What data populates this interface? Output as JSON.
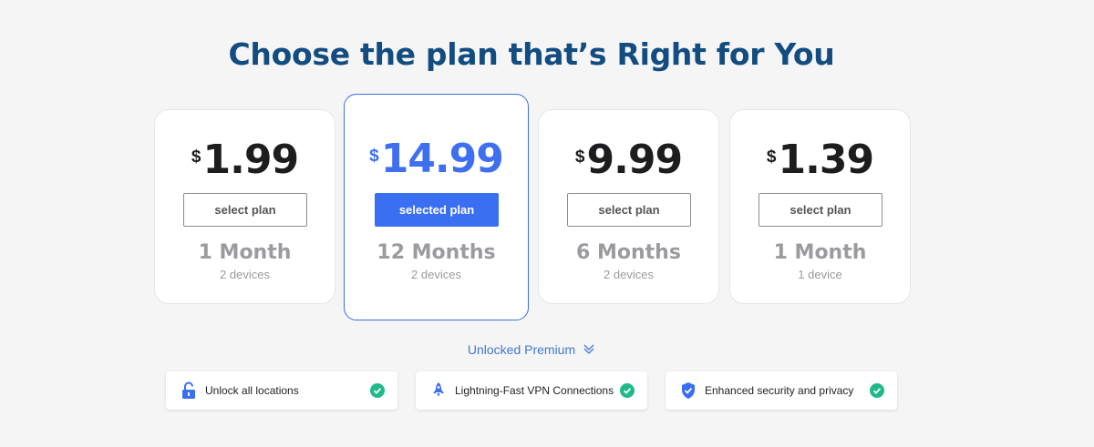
{
  "header": {
    "title": "Choose the plan that’s Right for You"
  },
  "plans": [
    {
      "currency": "$",
      "price": "1.99",
      "button": "select plan",
      "duration": "1 Month",
      "devices": "2 devices",
      "selected": false
    },
    {
      "currency": "$",
      "price": "14.99",
      "button": "selected plan",
      "duration": "12 Months",
      "devices": "2 devices",
      "selected": true
    },
    {
      "currency": "$",
      "price": "9.99",
      "button": "select plan",
      "duration": "6 Months",
      "devices": "2 devices",
      "selected": false
    },
    {
      "currency": "$",
      "price": "1.39",
      "button": "select plan",
      "duration": "1 Month",
      "devices": "1 device",
      "selected": false
    }
  ],
  "premium": {
    "label": "Unlocked Premium",
    "icon": "chevron-double-down-icon"
  },
  "features": [
    {
      "label": "Unlock all locations",
      "icon": "unlock-icon"
    },
    {
      "label": "Lightning-Fast VPN Connections",
      "icon": "rocket-icon"
    },
    {
      "label": "Enhanced security and privacy",
      "icon": "shield-check-icon"
    }
  ],
  "colors": {
    "title": "#124c80",
    "accent": "#3a6ff2",
    "muted": "#9b9b9f",
    "check": "#1fb98a"
  }
}
